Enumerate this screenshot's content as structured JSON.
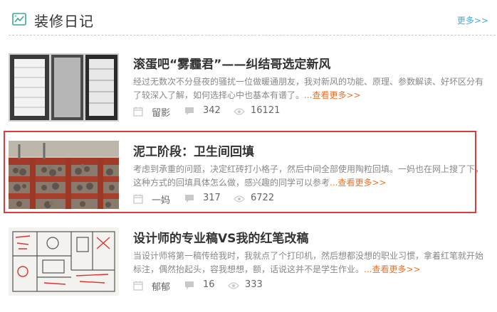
{
  "header": {
    "title": "装修日记",
    "more_label": "更多>>"
  },
  "articles": [
    {
      "title": "滚蛋吧“雾霾君”——纠结哥选定新风",
      "desc": "经过无数次不分昼夜的骚扰一位做暖通朋友，我对新风的功能、原理、参数解读、好坏区分有了较深入了解，如何选择心中也基本有谱了。",
      "read_more": "...查看更多>>",
      "author": "留影",
      "comments": "342",
      "views": "16121"
    },
    {
      "title": "泥工阶段：卫生间回填",
      "desc": "考虑到承重的问题，决定红砖打小格子，然后中间全部使用陶粒回填。一妈也在网上搜了下，这种方式的回填具体怎么做，感兴趣的同学可以参考",
      "read_more": "...查看更多>>",
      "author": "一妈",
      "comments": "317",
      "views": "6722"
    },
    {
      "title": "设计师的专业稿VS我的红笔改稿",
      "desc": "当设计师将第一稿传给我时，我就点了个打印机，然后想都没想的职业习惯，拿着红笔就开始标注，偶然抬起头，容我想想，额，话说这并不是学生作业。",
      "read_more": "...查看更多>>",
      "author": "郁郁",
      "comments": "16",
      "views": "333"
    }
  ]
}
